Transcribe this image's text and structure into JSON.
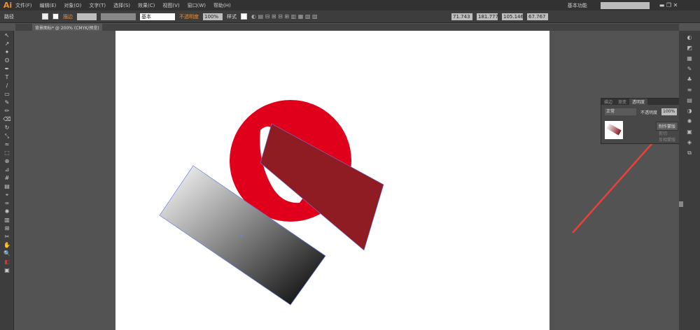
{
  "menubar": {
    "logo": "Ai",
    "items": [
      "文件(F)",
      "编辑(E)",
      "对象(O)",
      "文字(T)",
      "选择(S)",
      "效果(C)",
      "视图(V)",
      "窗口(W)",
      "帮助(H)"
    ],
    "workspace": "基本功能"
  },
  "control": {
    "selection": "路径",
    "stroke_label": "描边",
    "brush": "基本",
    "opacity_label": "不透明度",
    "opacity": "100%",
    "style_label": "样式",
    "x": "71.743",
    "y": "181.777",
    "w": "105.146",
    "h": "67.767"
  },
  "document": {
    "tab": "背景图标* @ 200% (CMYK/预览)"
  },
  "panel": {
    "tabs": [
      "描边",
      "渐变",
      "透明度"
    ],
    "blend_mode": "正常",
    "opacity_label": "不透明度",
    "opacity": "100%",
    "make_mask": "制作蒙版",
    "clip": "剪切",
    "invert_mask": "反相蒙版"
  },
  "colors": {
    "red": "#e0001b",
    "dark_red": "#8e1c22",
    "arrow": "#e8413b"
  }
}
